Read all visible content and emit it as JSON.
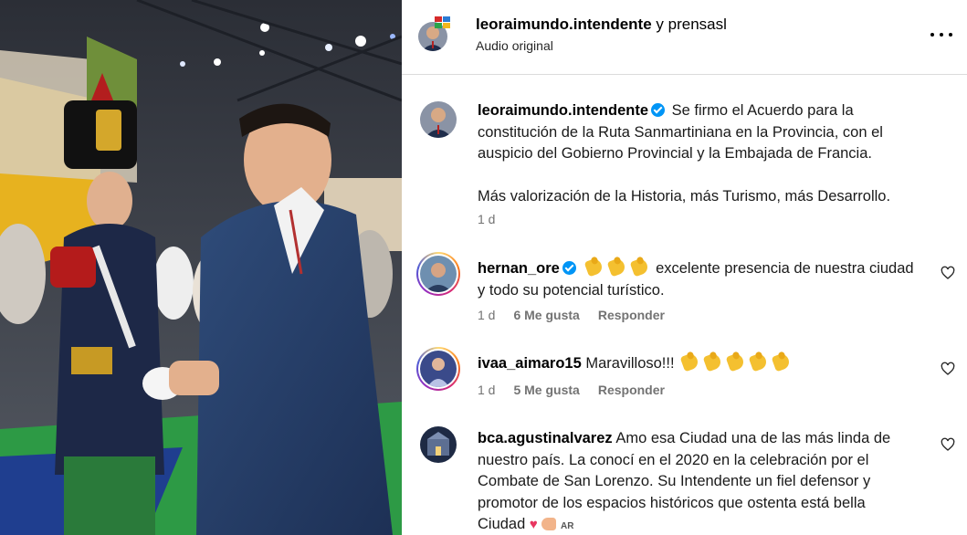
{
  "header": {
    "username": "leoraimundo.intendente",
    "connector": "y",
    "collaborator": "prensasl",
    "subtitle": "Audio original"
  },
  "caption": {
    "username": "leoraimundo.intendente",
    "verified": true,
    "paragraph1": "Se firmo el Acuerdo para la constitución de la Ruta Sanmartiniana en la Provincia, con el auspicio del Gobierno Provincial y la Embajada de Francia.",
    "paragraph2": "Más valorización de la Historia, más Turismo, más Desarrollo.",
    "time": "1 d"
  },
  "comments": [
    {
      "username": "hernan_ore",
      "verified": true,
      "emoji": [
        "clapping-hands",
        "clapping-hands",
        "clapping-hands"
      ],
      "text": "excelente presencia de nuestra ciudad y todo su potencial turístico.",
      "time": "1 d",
      "likes": "6 Me gusta",
      "reply": "Responder"
    },
    {
      "username": "ivaa_aimaro15",
      "verified": false,
      "text": "Maravilloso!!!",
      "emoji": [
        "clapping-hands",
        "clapping-hands",
        "clapping-hands",
        "clapping-hands",
        "clapping-hands"
      ],
      "time": "1 d",
      "likes": "5 Me gusta",
      "reply": "Responder"
    },
    {
      "username": "bca.agustinalvarez",
      "verified": false,
      "text": "Amo esa Ciudad una de las más linda de nuestro país. La conocí en el 2020 en la celebración por el Combate de San Lorenzo. Su Intendente un fiel defensor y promotor de los espacios históricos que ostenta está bella Ciudad",
      "trailing_emoji": [
        "heart",
        "flexed-biceps"
      ],
      "flag_text": "AR"
    }
  ],
  "icons": {
    "more": "more-options-icon",
    "like": "heart-outline-icon",
    "verified": "verified-badge-icon"
  },
  "colors": {
    "verified": "#0095f6",
    "meta_text": "#737373",
    "divider": "#dbdbdb"
  }
}
